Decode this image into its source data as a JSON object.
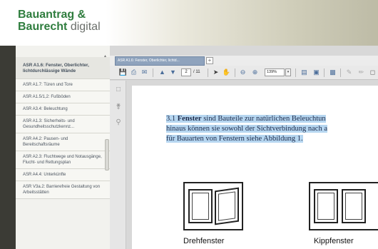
{
  "header": {
    "logo_line1": "Bauantrag &",
    "logo_line2_bold": "Baurecht",
    "logo_line2_light": "digital"
  },
  "sidebar": {
    "items": [
      {
        "label": "ASR A1.6: Fenster, Oberlichter, lichtdurchlässige Wände",
        "active": true
      },
      {
        "label": "ASR A1.7: Türen und Tore"
      },
      {
        "label": "ASR A1.5/1,2: Fußböden"
      },
      {
        "label": "ASR A3.4: Beleuchtung"
      },
      {
        "label": "ASR A1.3: Sicherheits- und Gesundheitsschutzkennz..."
      },
      {
        "label": "ASR A4.2: Pausen- und Bereitschaftsräume"
      },
      {
        "label": "ASR A2.3: Fluchtwege und Notausgänge, Flucht- und Rettungsplan"
      },
      {
        "label": "ASR A4.4: Unterkünfte"
      },
      {
        "label": "ASR V3a.2: Barrierefreie Gestaltung von Arbeitsstätten"
      }
    ]
  },
  "viewer": {
    "tab_label": "ASR A1.6: Fenster, Oberlichter, lichtd...",
    "tab_add": "+",
    "page_current": "2",
    "page_total": "/ 11",
    "zoom": "139%",
    "zoom_dropdown": "▾"
  },
  "document": {
    "line1_prefix": "3.1 ",
    "line1_bold": "Fenster",
    "line1_rest": " sind Bauteile zur natürlichen Beleuchtun",
    "line2": "hinaus können sie sowohl der Sichtverbindung nach a",
    "line3": "für Bauarten von Fenstern siehe Abbildung 1.",
    "figure_labels": [
      "Drehfenster",
      "Kippfenster"
    ]
  },
  "colors": {
    "brand_green": "#2f7d3e",
    "tab_blue": "#8fa3bd",
    "highlight": "#b6d6f0"
  }
}
